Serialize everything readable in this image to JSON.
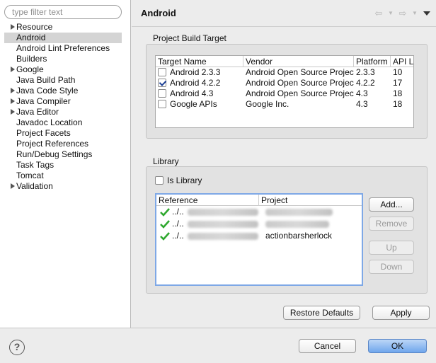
{
  "filter": {
    "placeholder": "type filter text"
  },
  "tree": {
    "items": [
      {
        "label": "Resource",
        "expandable": true
      },
      {
        "label": "Android",
        "expandable": false,
        "selected": true
      },
      {
        "label": "Android Lint Preferences",
        "expandable": false
      },
      {
        "label": "Builders",
        "expandable": false
      },
      {
        "label": "Google",
        "expandable": true
      },
      {
        "label": "Java Build Path",
        "expandable": false
      },
      {
        "label": "Java Code Style",
        "expandable": true
      },
      {
        "label": "Java Compiler",
        "expandable": true
      },
      {
        "label": "Java Editor",
        "expandable": true
      },
      {
        "label": "Javadoc Location",
        "expandable": false
      },
      {
        "label": "Project Facets",
        "expandable": false
      },
      {
        "label": "Project References",
        "expandable": false
      },
      {
        "label": "Run/Debug Settings",
        "expandable": false
      },
      {
        "label": "Task Tags",
        "expandable": false
      },
      {
        "label": "Tomcat",
        "expandable": false
      },
      {
        "label": "Validation",
        "expandable": true
      }
    ]
  },
  "header": {
    "title": "Android",
    "nav_back_icon": "arrow-left-icon",
    "nav_forward_icon": "arrow-right-icon",
    "view_menu_icon": "chevron-down-icon"
  },
  "build_target": {
    "section_label": "Project Build Target",
    "columns": [
      "Target Name",
      "Vendor",
      "Platform",
      "API Le"
    ],
    "rows": [
      {
        "name": "Android 2.3.3",
        "vendor": "Android Open Source Project",
        "platform": "2.3.3",
        "api": "10",
        "checked": false
      },
      {
        "name": "Android 4.2.2",
        "vendor": "Android Open Source Project",
        "platform": "4.2.2",
        "api": "17",
        "checked": true
      },
      {
        "name": "Android 4.3",
        "vendor": "Android Open Source Project",
        "platform": "4.3",
        "api": "18",
        "checked": false
      },
      {
        "name": "Google APIs",
        "vendor": "Google Inc.",
        "platform": "4.3",
        "api": "18",
        "checked": false
      }
    ]
  },
  "library": {
    "section_label": "Library",
    "is_library_label": "Is Library",
    "is_library_checked": false,
    "columns": [
      "Reference",
      "Project"
    ],
    "rows": [
      {
        "reference": "../..",
        "project": ""
      },
      {
        "reference": "../..",
        "project": ""
      },
      {
        "reference": "../..",
        "project": "actionbarsherlock"
      }
    ],
    "buttons": {
      "add": "Add...",
      "remove": "Remove",
      "up": "Up",
      "down": "Down"
    }
  },
  "actions": {
    "restore_defaults": "Restore Defaults",
    "apply": "Apply"
  },
  "footer": {
    "help_icon": "help-icon",
    "help_glyph": "?",
    "cancel": "Cancel",
    "ok": "OK"
  },
  "colors": {
    "accent": "#6fa6ec",
    "check_green": "#2fa82f",
    "selection": "#d4d4d4"
  }
}
